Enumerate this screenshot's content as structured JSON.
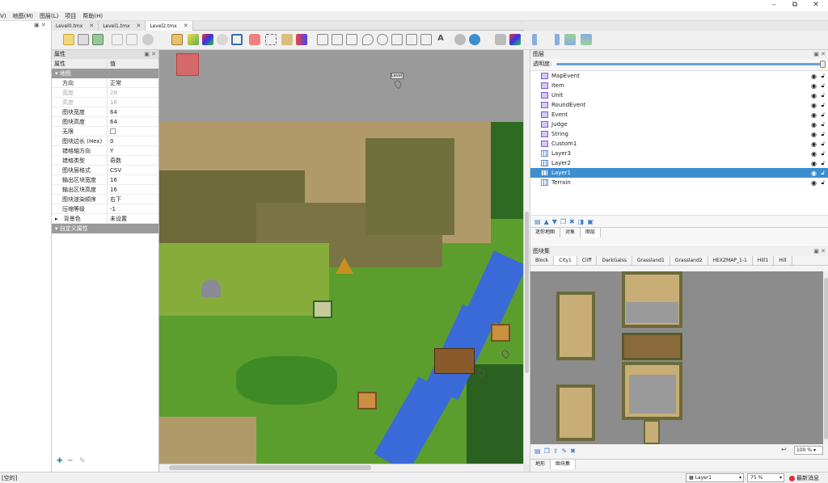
{
  "menu": {
    "items": [
      "V)",
      "地图(M)",
      "图层(L)",
      "项目",
      "帮助(H)"
    ]
  },
  "window": {
    "minimize": "–",
    "restore": "⧉",
    "close": "✕"
  },
  "tabs": [
    {
      "label": "Level0.tmx",
      "close": "✕"
    },
    {
      "label": "Level1.tmx",
      "close": "✕"
    },
    {
      "label": "Level2.tmx",
      "close": "✕"
    }
  ],
  "properties": {
    "title": "属性",
    "col_name": "属性",
    "col_value": "值",
    "group_map": "地图",
    "rows": [
      {
        "k": "方向",
        "v": "正常"
      },
      {
        "k": "宽度",
        "v": "28"
      },
      {
        "k": "高度",
        "v": "16"
      },
      {
        "k": "图块宽度",
        "v": "64"
      },
      {
        "k": "图块高度",
        "v": "64"
      },
      {
        "k": "无限",
        "v": ""
      },
      {
        "k": "图块边长 (Hex)",
        "v": "0"
      },
      {
        "k": "错格轴方向",
        "v": "Y"
      },
      {
        "k": "错格类型",
        "v": "奇数"
      },
      {
        "k": "图块层格式",
        "v": "CSV"
      },
      {
        "k": "输出区块宽度",
        "v": "16"
      },
      {
        "k": "输出区块高度",
        "v": "16"
      },
      {
        "k": "图块渲染顺序",
        "v": "右下"
      },
      {
        "k": "压缩等级",
        "v": "-1"
      },
      {
        "k": "背景色",
        "v": "未设置"
      }
    ],
    "group_custom": "自定义属性"
  },
  "canvas": {
    "marker_label": "Level3"
  },
  "layers": {
    "title": "图层",
    "opacity_label": "透明度:",
    "items": [
      {
        "name": "MapEvent",
        "type": "object"
      },
      {
        "name": "Item",
        "type": "object"
      },
      {
        "name": "Unit",
        "type": "object"
      },
      {
        "name": "RoundEvent",
        "type": "object"
      },
      {
        "name": "Event",
        "type": "object"
      },
      {
        "name": "Judge",
        "type": "object"
      },
      {
        "name": "String",
        "type": "object"
      },
      {
        "name": "Custom1",
        "type": "object"
      },
      {
        "name": "Layer3",
        "type": "tile"
      },
      {
        "name": "Layer2",
        "type": "tile"
      },
      {
        "name": "Layer1",
        "type": "tile",
        "selected": true
      },
      {
        "name": "Terrain",
        "type": "tile"
      }
    ],
    "bottom_tabs": [
      "迷你地图",
      "对象",
      "图层"
    ]
  },
  "tilesets": {
    "title": "图块集",
    "tabs": [
      "Block",
      "City1",
      "Cliff",
      "DarkGalss",
      "Grassland1",
      "Grassland2",
      "HEXZMAP_1-1",
      "Hill1",
      "Hill"
    ],
    "zoom": "100 %",
    "bottom_tabs": [
      "地形",
      "图块集"
    ]
  },
  "status": {
    "left": "[空的]",
    "layer": "Layer1",
    "zoom": "75 %",
    "news": "最新消息"
  },
  "colors": {
    "accent": "#3c8ecf",
    "selection": "#e06060"
  }
}
